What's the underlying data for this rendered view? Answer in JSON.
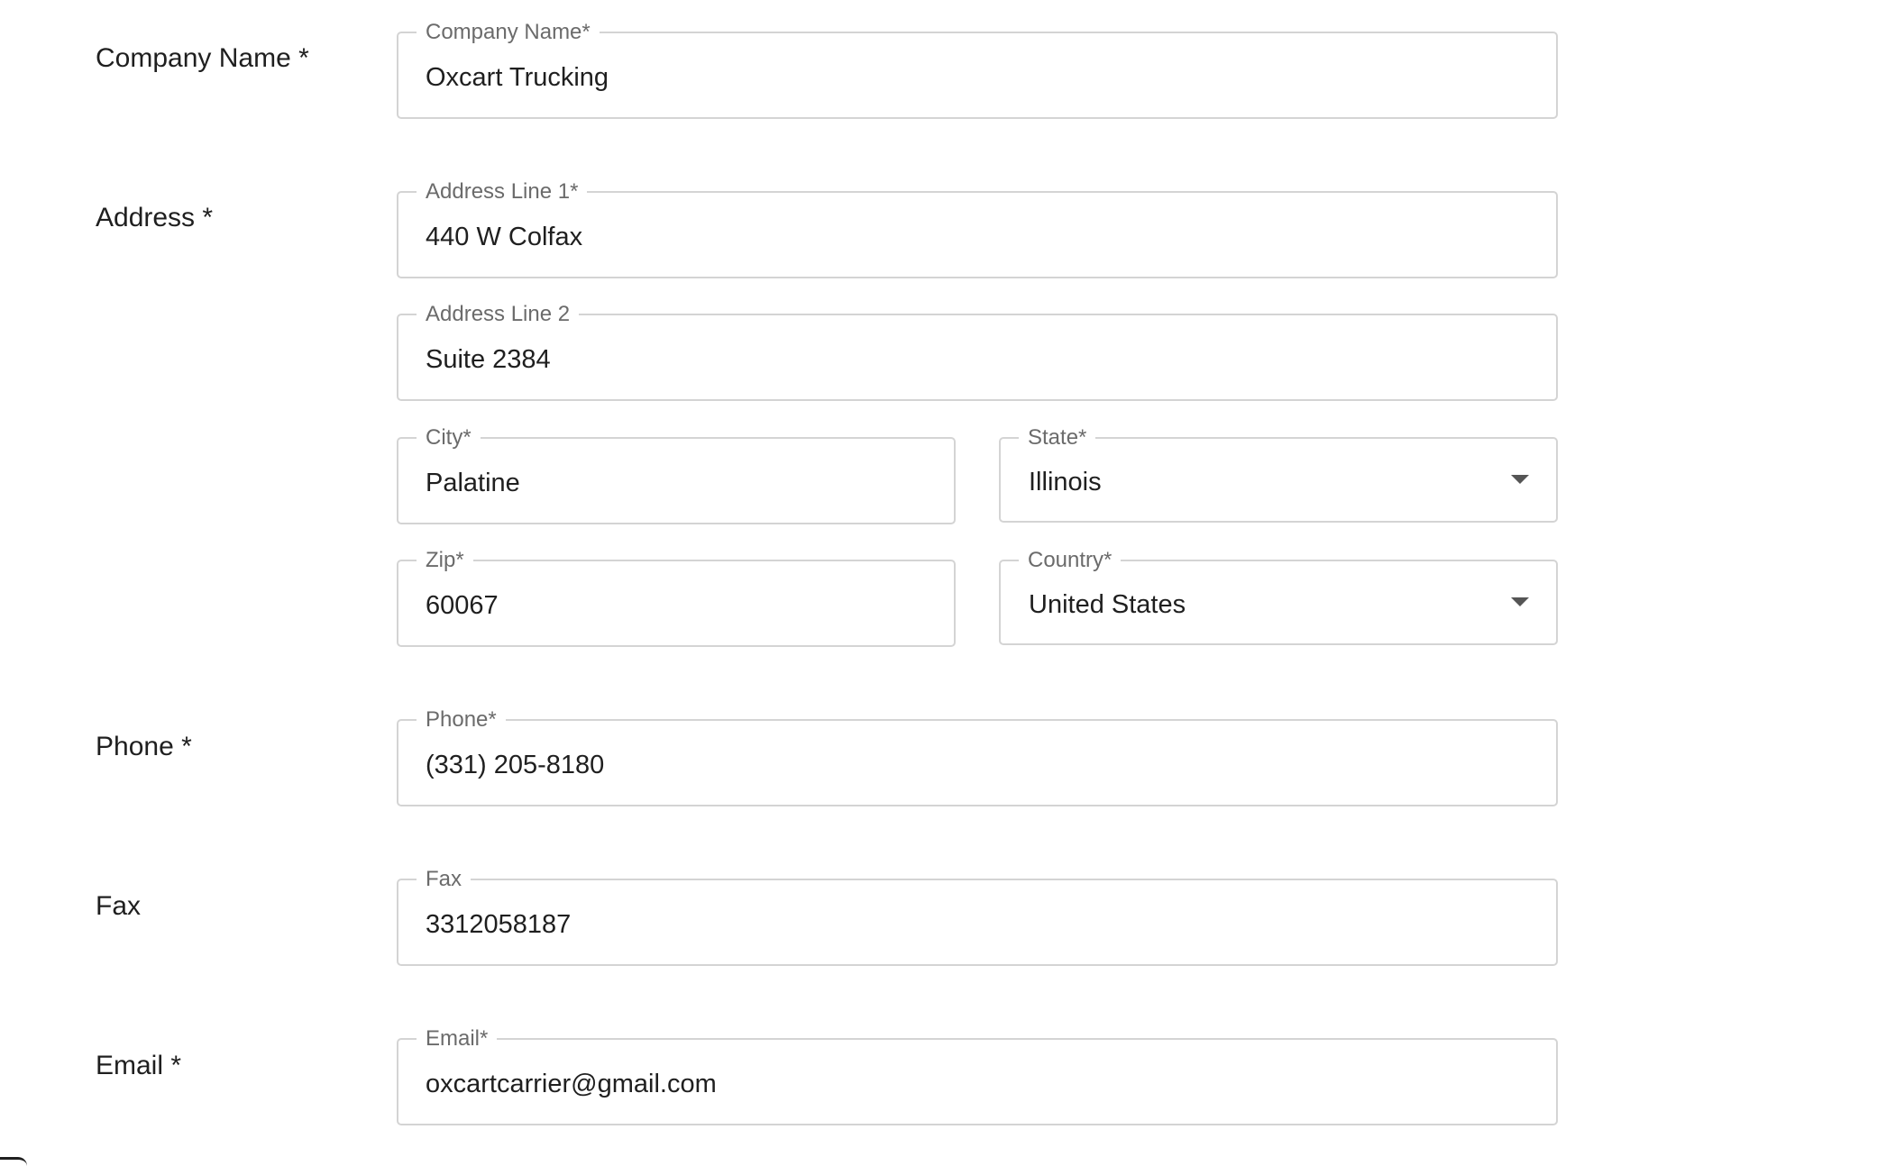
{
  "form": {
    "company": {
      "row_label": "Company Name *",
      "legend": "Company Name*",
      "value": "Oxcart Trucking"
    },
    "address": {
      "row_label": "Address *",
      "line1": {
        "legend": "Address Line 1*",
        "value": "440 W Colfax"
      },
      "line2": {
        "legend": "Address Line 2",
        "value": "Suite 2384"
      },
      "city": {
        "legend": "City*",
        "value": "Palatine"
      },
      "state": {
        "legend": "State*",
        "value": "Illinois",
        "icon": "chevron-down-icon"
      },
      "zip": {
        "legend": "Zip*",
        "value": "60067"
      },
      "country": {
        "legend": "Country*",
        "value": "United States",
        "icon": "chevron-down-icon"
      }
    },
    "phone": {
      "row_label": "Phone *",
      "legend": "Phone*",
      "value": "(331) 205-8180"
    },
    "fax": {
      "row_label": "Fax",
      "legend": "Fax",
      "value": "3312058187"
    },
    "email": {
      "row_label": "Email *",
      "legend": "Email*",
      "value": "oxcartcarrier@gmail.com"
    }
  },
  "colors": {
    "border": "#d4d4d4",
    "legend_text": "#6b6b6b",
    "text": "#1f1f1f",
    "caret": "#555555"
  }
}
